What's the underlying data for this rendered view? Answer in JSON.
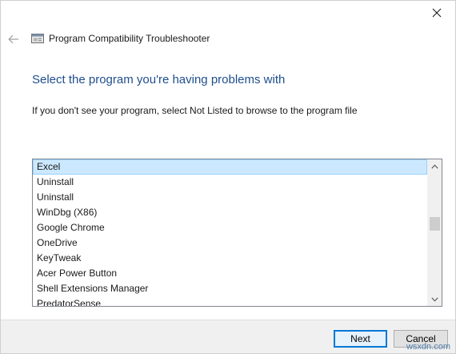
{
  "window": {
    "title": "Program Compatibility Troubleshooter"
  },
  "content": {
    "heading": "Select the program you're having problems with",
    "instruction": "If you don't see your program, select Not Listed to browse to the program file"
  },
  "program_list": {
    "items": [
      {
        "label": "Excel",
        "selected": true
      },
      {
        "label": "Uninstall",
        "selected": false
      },
      {
        "label": "Uninstall",
        "selected": false
      },
      {
        "label": "WinDbg (X86)",
        "selected": false
      },
      {
        "label": "Google Chrome",
        "selected": false
      },
      {
        "label": "OneDrive",
        "selected": false
      },
      {
        "label": "KeyTweak",
        "selected": false
      },
      {
        "label": "Acer Power Button",
        "selected": false
      },
      {
        "label": "Shell Extensions Manager",
        "selected": false
      },
      {
        "label": "PredatorSense",
        "selected": false
      }
    ],
    "scroll_position": 0.42
  },
  "footer": {
    "next_label": "Next",
    "cancel_label": "Cancel"
  },
  "watermark": "wsxdn.com",
  "colors": {
    "heading": "#1f4e8c",
    "selection_bg": "#cce8ff",
    "selection_border": "#99d1ff",
    "default_button_border": "#0078d7",
    "footer_bg": "#f0f0f0"
  },
  "icons": {
    "close": "close-icon",
    "back": "back-arrow-icon",
    "app": "troubleshooter-icon",
    "scroll_up": "chevron-up-icon",
    "scroll_down": "chevron-down-icon"
  }
}
